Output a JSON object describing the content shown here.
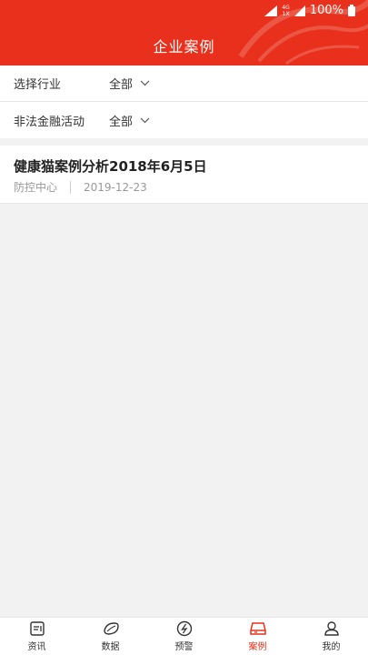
{
  "status_bar": {
    "network": "4G",
    "signal_sub": "1X",
    "battery": "100%"
  },
  "header": {
    "title": "企业案例"
  },
  "filters": [
    {
      "label": "选择行业",
      "value": "全部"
    },
    {
      "label": "非法金融活动",
      "value": "全部"
    }
  ],
  "articles": [
    {
      "title": "健康猫案例分析2018年6月5日",
      "source": "防控中心",
      "date": "2019-12-23"
    }
  ],
  "tabbar": {
    "active_color": "#e8301c",
    "items": [
      {
        "label": "资讯",
        "icon": "news-icon"
      },
      {
        "label": "数据",
        "icon": "data-icon"
      },
      {
        "label": "预警",
        "icon": "warning-icon"
      },
      {
        "label": "案例",
        "icon": "case-icon",
        "active": true
      },
      {
        "label": "我的",
        "icon": "user-icon"
      }
    ]
  }
}
